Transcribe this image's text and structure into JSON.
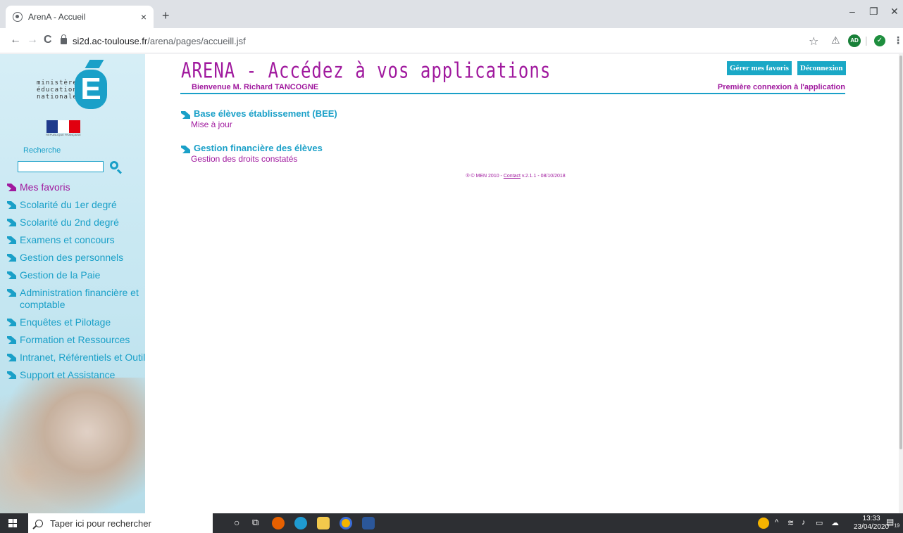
{
  "browser": {
    "tab_title": "ArenA - Accueil",
    "tab_close": "×",
    "new_tab": "+",
    "win_minimize": "–",
    "win_restore": "❐",
    "win_close": "✕",
    "back": "←",
    "forward": "→",
    "reload": "C",
    "url_host": "si2d.ac-toulouse.fr",
    "url_path": "/arena/pages/accueill.jsf",
    "bookmark_star": "☆",
    "profile_badge": "AD",
    "menu_dots": "⋮"
  },
  "logo": {
    "ministry_text": [
      "ministère",
      "éducation",
      "nationale"
    ],
    "e_letter": "E",
    "republic_text": "RÉPUBLIQUE FRANÇAISE",
    "flag_colors": [
      "#1f3a8c",
      "#ffffff",
      "#e1000f"
    ]
  },
  "sidebar": {
    "search_label": "Recherche",
    "search_value": "",
    "menu": [
      {
        "label": "Mes favoris",
        "favorite": true
      },
      {
        "label": "Scolarité du 1er degré"
      },
      {
        "label": "Scolarité du 2nd degré"
      },
      {
        "label": "Examens et concours"
      },
      {
        "label": "Gestion des personnels"
      },
      {
        "label": "Gestion de la Paie"
      },
      {
        "label": "Administration financière et comptable"
      },
      {
        "label": "Enquêtes et Pilotage"
      },
      {
        "label": "Formation et Ressources"
      },
      {
        "label": "Intranet, Référentiels et Outils"
      },
      {
        "label": "Support et Assistance"
      }
    ]
  },
  "header": {
    "title": "ARENA - Accédez à vos applications",
    "welcome": "Bienvenue M. Richard TANCOGNE",
    "manage_favorites": "Gérer mes favoris",
    "logout": "Déconnexion",
    "first_connection": "Première connexion à l'application"
  },
  "sections": [
    {
      "title": "Base élèves établissement (BEE)",
      "link": "Mise à jour"
    },
    {
      "title": "Gestion financière des élèves",
      "link": "Gestion des droits constatés"
    }
  ],
  "footer": {
    "prefix": "® © MEN 2010 - ",
    "contact": "Contact",
    "suffix": " v.2.1.1 - 08/10/2018"
  },
  "taskbar": {
    "search_placeholder": "Taper ici pour rechercher",
    "time": "13:33",
    "date": "23/04/2020",
    "notif_count": "19"
  },
  "colors": {
    "accent_cyan": "#1aa0c8",
    "accent_magenta": "#a0199e"
  }
}
